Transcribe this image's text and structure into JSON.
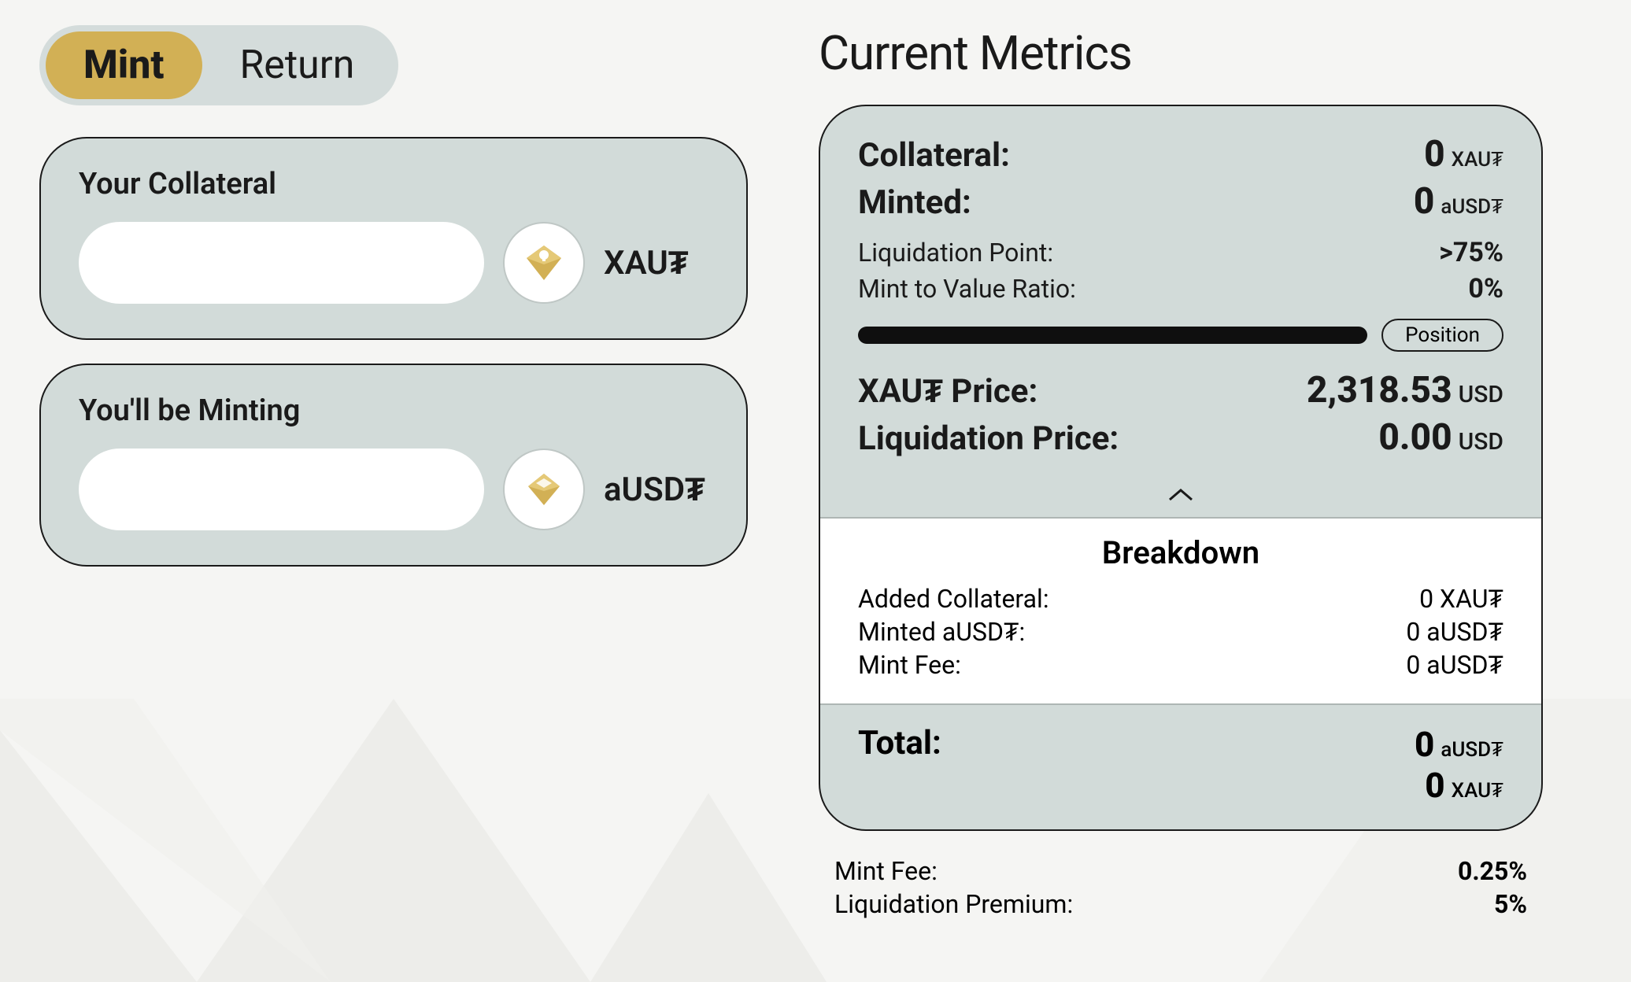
{
  "tabs": {
    "mint": "Mint",
    "return": "Return"
  },
  "collateral_card": {
    "label": "Your Collateral",
    "token": "XAU₮"
  },
  "minting_card": {
    "label": "You'll be Minting",
    "token": "aUSD₮"
  },
  "metrics_title": "Current Metrics",
  "metrics": {
    "collateral_label": "Collateral:",
    "collateral_value": "0",
    "collateral_unit": "XAU₮",
    "minted_label": "Minted:",
    "minted_value": "0",
    "minted_unit": "aUSD₮",
    "liq_point_label": "Liquidation Point:",
    "liq_point_value": ">75%",
    "mtv_label": "Mint to Value Ratio:",
    "mtv_value": "0%",
    "position_label": "Position",
    "xaut_price_label": "XAU₮ Price:",
    "xaut_price_value": "2,318.53",
    "xaut_price_unit": "USD",
    "liq_price_label": "Liquidation Price:",
    "liq_price_value": "0.00",
    "liq_price_unit": "USD"
  },
  "breakdown": {
    "title": "Breakdown",
    "rows": [
      {
        "label": "Added Collateral:",
        "value": "0 XAU₮"
      },
      {
        "label": "Minted aUSD₮:",
        "value": "0 aUSD₮"
      },
      {
        "label": "Mint Fee:",
        "value": "0 aUSD₮"
      }
    ]
  },
  "total": {
    "label": "Total:",
    "ausd_value": "0",
    "ausd_unit": "aUSD₮",
    "xaut_value": "0",
    "xaut_unit": "XAU₮"
  },
  "footer": {
    "mint_fee_label": "Mint Fee:",
    "mint_fee_value": "0.25%",
    "liq_premium_label": "Liquidation Premium:",
    "liq_premium_value": "5%"
  }
}
